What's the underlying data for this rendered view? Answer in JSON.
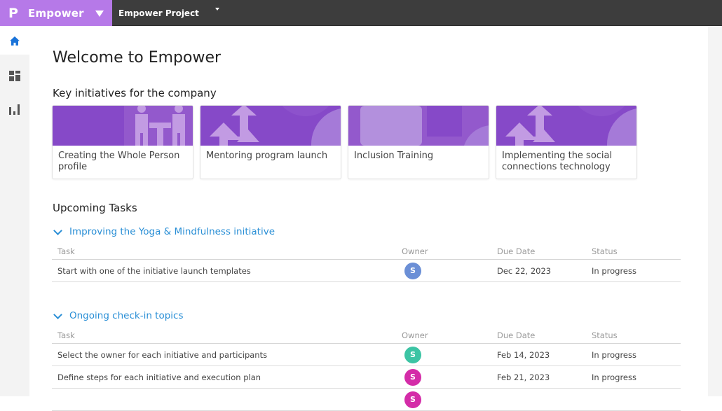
{
  "topbar": {
    "brand_logo": "P",
    "brand_name": "Empower",
    "project_name": "Empower Project"
  },
  "sidebar": {
    "items": [
      {
        "name": "home",
        "icon": "home-icon",
        "active": true
      },
      {
        "name": "dashboard",
        "icon": "dashboard-icon",
        "active": false
      },
      {
        "name": "reports",
        "icon": "bar-chart-icon",
        "active": false
      }
    ]
  },
  "colors": {
    "brand": "#b679e8",
    "topbar": "#3d3d3d",
    "card_banner": "#8649c8",
    "link": "#2a8fd6",
    "active_nav": "#1a73d9"
  },
  "main": {
    "title": "Welcome to Empower",
    "initiatives_title": "Key initiatives for the company",
    "initiatives": [
      {
        "label": "Creating the Whole Person profile",
        "banner": "people-meeting"
      },
      {
        "label": "Mentoring program launch",
        "banner": "arrows-up"
      },
      {
        "label": "Inclusion Training",
        "banner": "abstract-shapes"
      },
      {
        "label": "Implementing the social connections technology",
        "banner": "arrows-up"
      }
    ],
    "tasks_title": "Upcoming Tasks",
    "columns": {
      "task": "Task",
      "owner": "Owner",
      "due": "Due Date",
      "status": "Status"
    },
    "groups": [
      {
        "title": "Improving the Yoga & Mindfulness initiative",
        "rows": [
          {
            "task": "Start with one of the initiative launch templates",
            "owner": "S",
            "owner_color": "#6b8fd6",
            "due": "Dec 22, 2023",
            "status": "In progress"
          }
        ]
      },
      {
        "title": "Ongoing check-in topics",
        "rows": [
          {
            "task": "Select the owner for each initiative and participants",
            "owner": "S",
            "owner_color": "#3cc4a4",
            "due": "Feb 14, 2023",
            "status": "In progress"
          },
          {
            "task": "Define steps for each initiative and execution plan",
            "owner": "S",
            "owner_color": "#d42ca8",
            "due": "Feb 21, 2023",
            "status": "In progress"
          },
          {
            "task": "",
            "owner": "S",
            "owner_color": "#d42ca8",
            "due": "",
            "status": ""
          }
        ]
      }
    ]
  }
}
